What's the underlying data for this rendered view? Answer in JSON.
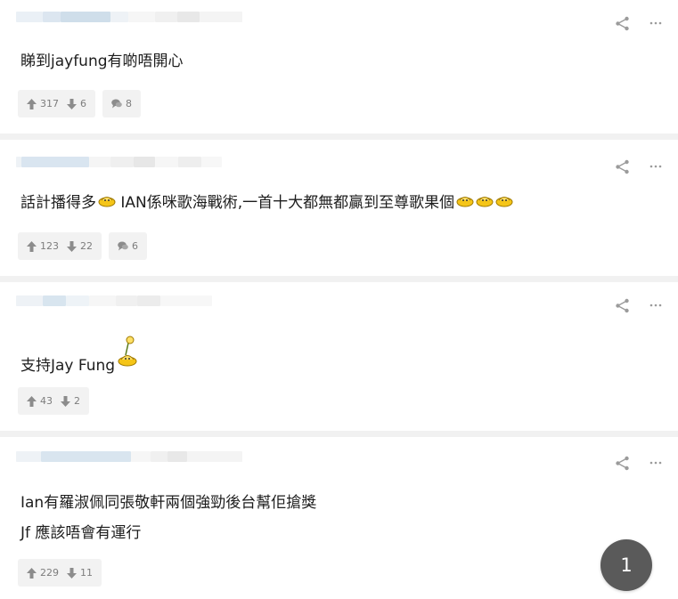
{
  "icons": {
    "share": "share-icon",
    "more": "more-icon",
    "upvote": "thumb-up-icon",
    "downvote": "thumb-down-icon",
    "reply": "speech-bubble-icon",
    "emoji": "emoji-icon"
  },
  "colors": {
    "separator": "#f1f1f1",
    "pill_bg": "#f2f2f2",
    "pill_text": "#7d7d7d",
    "icon_gray": "#9b9b9b",
    "page_bubble": "#5a5a5a"
  },
  "comments": [
    {
      "text": "睇到jayfung有啲唔開心",
      "upvotes": "317",
      "downvotes": "6",
      "replies": "8"
    },
    {
      "text": "話計播得多",
      "text_rest": " IAN係咪歌海戰術,一首十大都無都贏到至尊歌果個",
      "upvotes": "123",
      "downvotes": "22",
      "replies": "6"
    },
    {
      "text": "支持Jay Fung",
      "upvotes": "43",
      "downvotes": "2"
    },
    {
      "text": "Ian有羅淑佩同張敬軒兩個強勁後台幫佢搶獎\nJf 應該唔會有運行",
      "upvotes": "229",
      "downvotes": "11"
    }
  ],
  "pagination": {
    "current": "1"
  }
}
